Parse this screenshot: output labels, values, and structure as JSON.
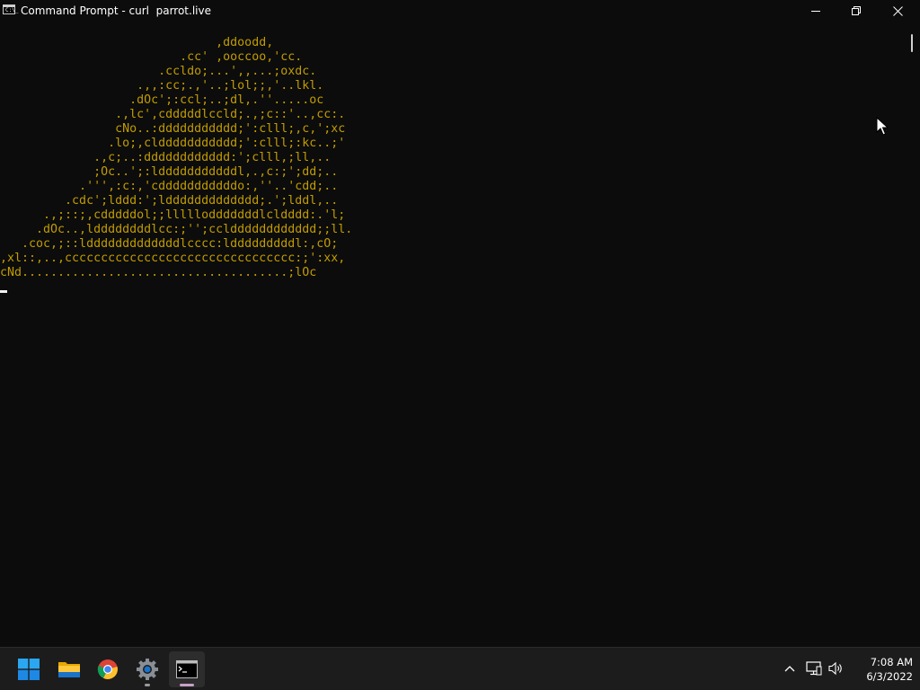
{
  "window": {
    "title": "Command Prompt - curl  parrot.live",
    "icon": "cmd-icon",
    "icon_prompt": "C:\\_",
    "controls": [
      "minimize-icon",
      "restore-icon",
      "close-icon"
    ]
  },
  "terminal": {
    "ascii_art": "                              ,ddoodd,\n                         .cc' ,ooccoo,'cc.\n                      .ccldo;...',,...;oxdc.\n                   .,,:cc;.,'..;lol;;,'..lkl.\n                  .dOc';:ccl;..;dl,.''.....oc\n                .,lc',cdddddlccld;.,;c::'..,cc:.\n                cNo..:ddddddddddd;':clll;,c,';xc\n               .lo;,clddddddddddd;':clll;:kc..;'\n             .,c;..:dddddddddddd:';clll,;ll,..\n             ;Oc..';:ldddddddddddl,.,c:;';dd;..\n           .''',:c:,'cdddddddddddo:,''..'cdd;..\n         .cdc';lddd:';lddddddddddddd;.';lddl,..\n      .,;::;,cdddddol;;lllllodddddddlcldddd:.'l;\n     .dOc..,lddddddddlcc:;'';ccldddddddddddd;;ll.\n   .coc,;::ldddddddddddddlcccc:ldddddddddl:,cO;\n,xl::,..,cccccccccccccccccccccccccccccccc:;':xx,\ncNd.....................................;lOc",
    "text_color": "#c19c00",
    "background": "#0c0c0c"
  },
  "taskbar": {
    "apps": [
      {
        "name": "start",
        "icon": "windows-start-icon"
      },
      {
        "name": "file-explorer",
        "icon": "folder-icon"
      },
      {
        "name": "chrome",
        "icon": "chrome-icon"
      },
      {
        "name": "settings",
        "icon": "gear-icon"
      },
      {
        "name": "command-prompt",
        "icon": "terminal-icon"
      }
    ],
    "tray": [
      "chevron-up-icon",
      "network-icon",
      "volume-icon"
    ],
    "time": "7:08 AM",
    "date": "6/3/2022"
  },
  "colors": {
    "accent": "#0078d4",
    "taskbar_bg": "#1c1c1c",
    "active_indicator": "#c8a0c8"
  }
}
